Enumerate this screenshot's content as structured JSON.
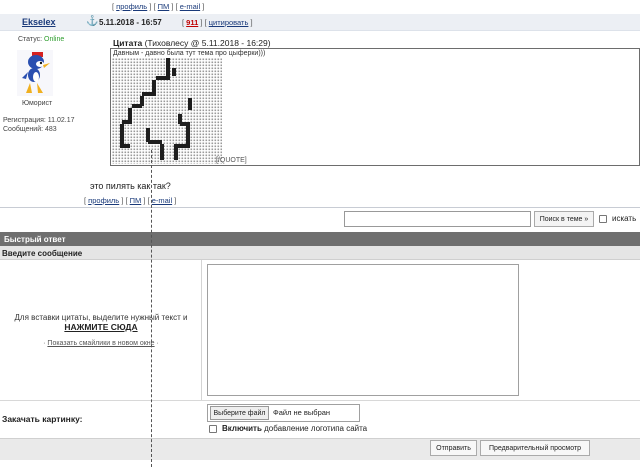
{
  "top_links": {
    "profile": "профиль",
    "pm": "ПМ",
    "email": "e-mail"
  },
  "post": {
    "author": "Ekselex",
    "date": "5.11.2018 - 16:57",
    "number": "911",
    "quote_link": "цитировать",
    "status_label": "Статус:",
    "status_value": "Online",
    "rank": "Юморист",
    "registration": "Регистрация: 11.02.17",
    "messages": "Сообщений: 483",
    "quote_title": "Цитата",
    "quote_meta": "(Тиховлесу @ 5.11.2018 - 16:29)",
    "quote_text": "Давным - давно была тут тема про цыферки)))",
    "quote_tag": "[/QUOTE]",
    "message": "это пилять как так?"
  },
  "bottom_links": {
    "profile": "профиль",
    "pm": "ПМ",
    "email": "e-mail"
  },
  "search": {
    "button": "Поиск в теме »",
    "checkbox_label": "искать"
  },
  "quick_reply": {
    "title": "Быстрый ответ",
    "enter_message": "Введите сообщение",
    "hint": "Для вставки цитаты, выделите нужный текст и",
    "hint_action": "НАЖМИТЕ СЮДА",
    "smilies_link": "Показать смайлики в новом окне",
    "upload_label": "Закачать картинку:",
    "file_button": "Выберите файл",
    "file_status": "Файл не выбран",
    "logo_bold": "Включить",
    "logo_rest": "добавление логотипа сайта",
    "send": "Отправить",
    "preview": "Предварительный просмотр"
  },
  "colors": {
    "link": "#1a3a7a",
    "online": "#2e9e2e",
    "post_number": "#c00000",
    "quick_reply_bar": "#6f6f6f"
  }
}
